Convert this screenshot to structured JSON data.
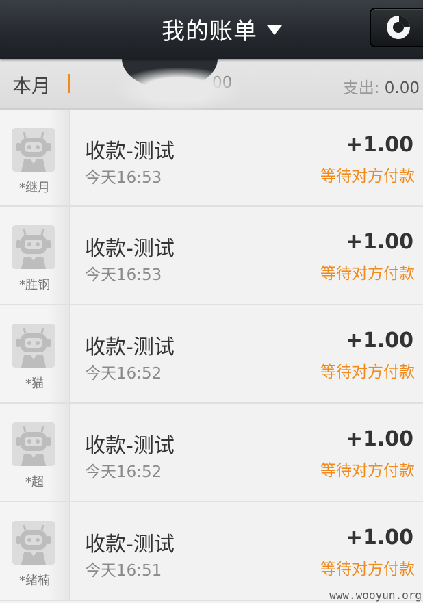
{
  "header": {
    "title": "我的账单",
    "chart_button_icon": "pie-chart-icon"
  },
  "summary": {
    "period": "本月",
    "income_fragment": "00",
    "expense_label": "支出:",
    "expense_value": "0.00"
  },
  "records": [
    {
      "nickname": "*继月",
      "title": "收款-测试",
      "time": "今天16:53",
      "amount": "+1.00",
      "status": "等待对方付款"
    },
    {
      "nickname": "*胜钢",
      "title": "收款-测试",
      "time": "今天16:53",
      "amount": "+1.00",
      "status": "等待对方付款"
    },
    {
      "nickname": "*猫",
      "title": "收款-测试",
      "time": "今天16:52",
      "amount": "+1.00",
      "status": "等待对方付款"
    },
    {
      "nickname": "*超",
      "title": "收款-测试",
      "time": "今天16:52",
      "amount": "+1.00",
      "status": "等待对方付款"
    },
    {
      "nickname": "*绪楠",
      "title": "收款-测试",
      "time": "今天16:51",
      "amount": "+1.00",
      "status": "等待对方付款"
    }
  ],
  "watermark": "www.wooyun.org",
  "colors": {
    "accent": "#f08a1a",
    "navbar": "#25292e",
    "background": "#f2f2f2"
  }
}
